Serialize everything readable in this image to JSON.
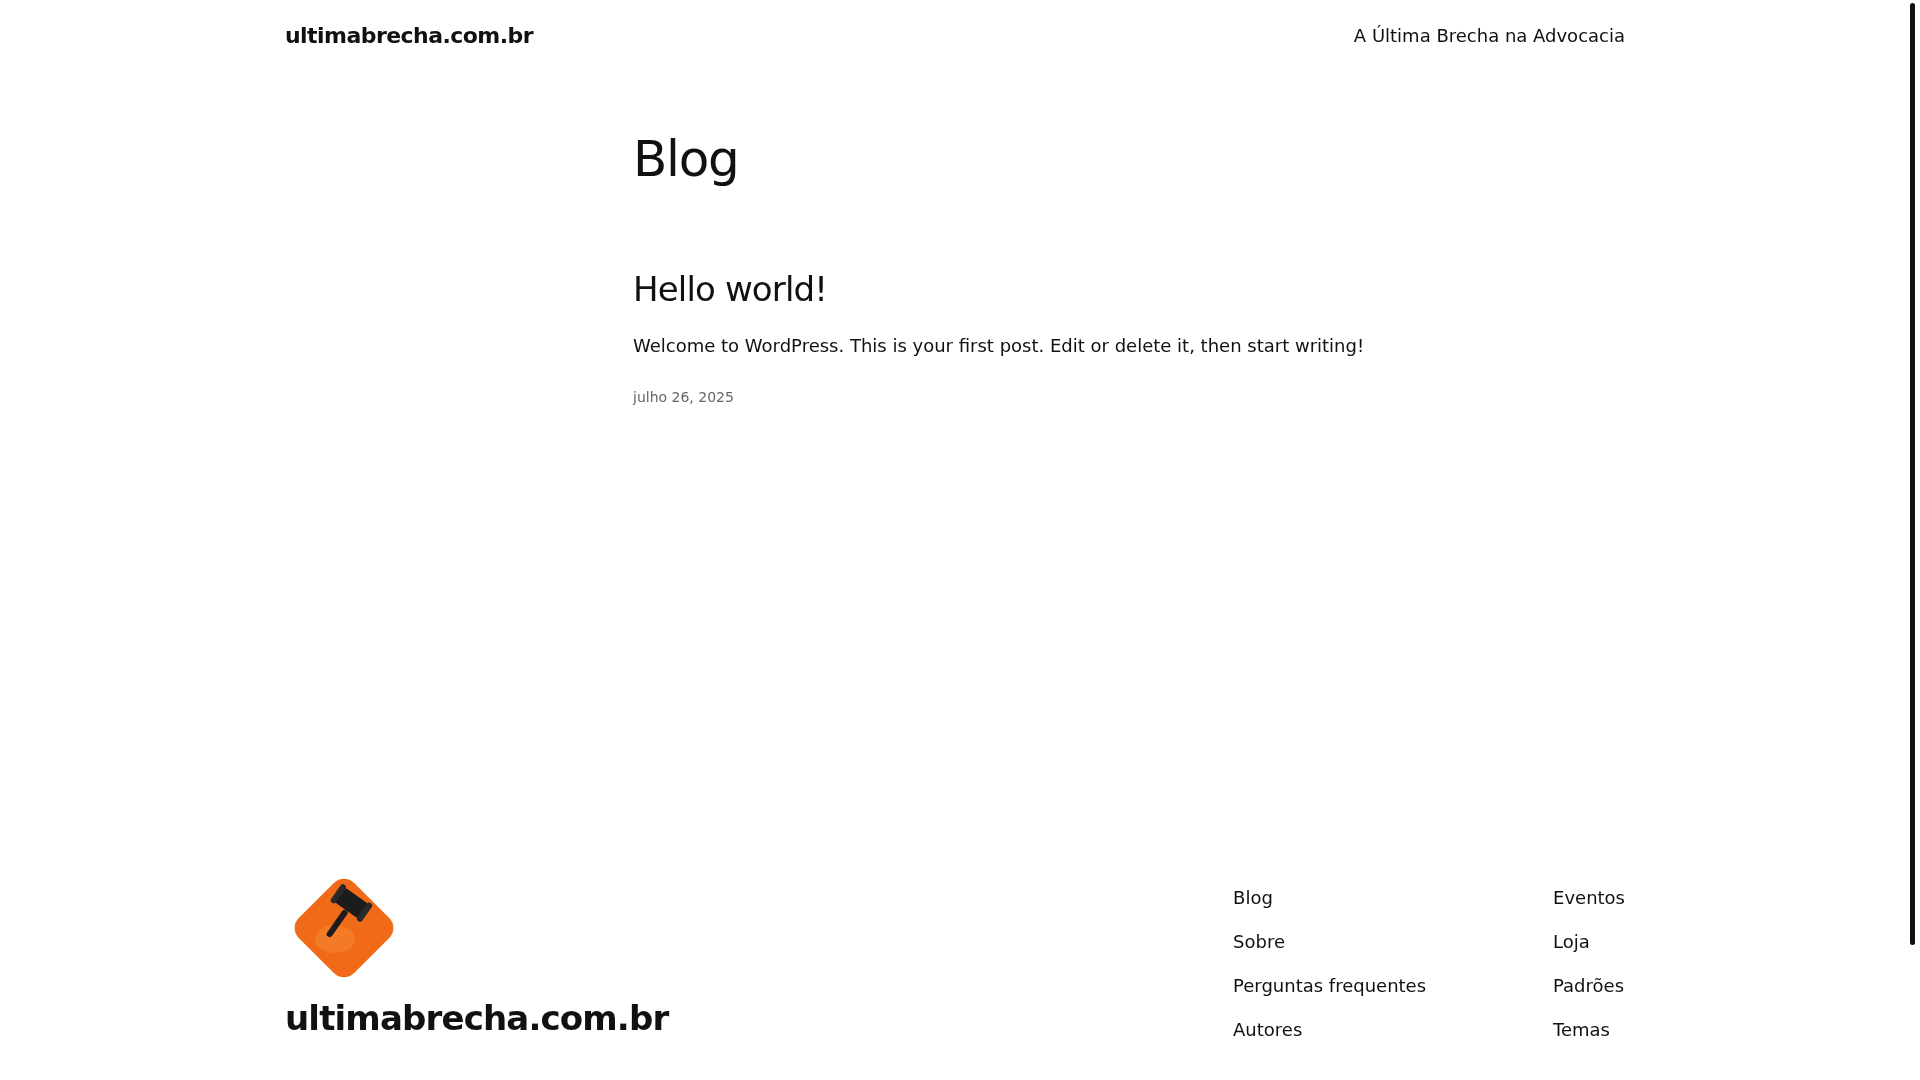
{
  "header": {
    "site_title": "ultimabrecha.com.br",
    "tagline": "A Última Brecha na Advocacia"
  },
  "page_title": "Blog",
  "posts": [
    {
      "title": "Hello world!",
      "excerpt": "Welcome to WordPress. This is your first post. Edit or delete it, then start writing!",
      "date": "julho 26, 2025"
    }
  ],
  "footer": {
    "site_title": "ultimabrecha.com.br",
    "nav_columns": [
      [
        "Blog",
        "Sobre",
        "Perguntas frequentes",
        "Autores"
      ],
      [
        "Eventos",
        "Loja",
        "Padrões",
        "Temas"
      ]
    ]
  }
}
